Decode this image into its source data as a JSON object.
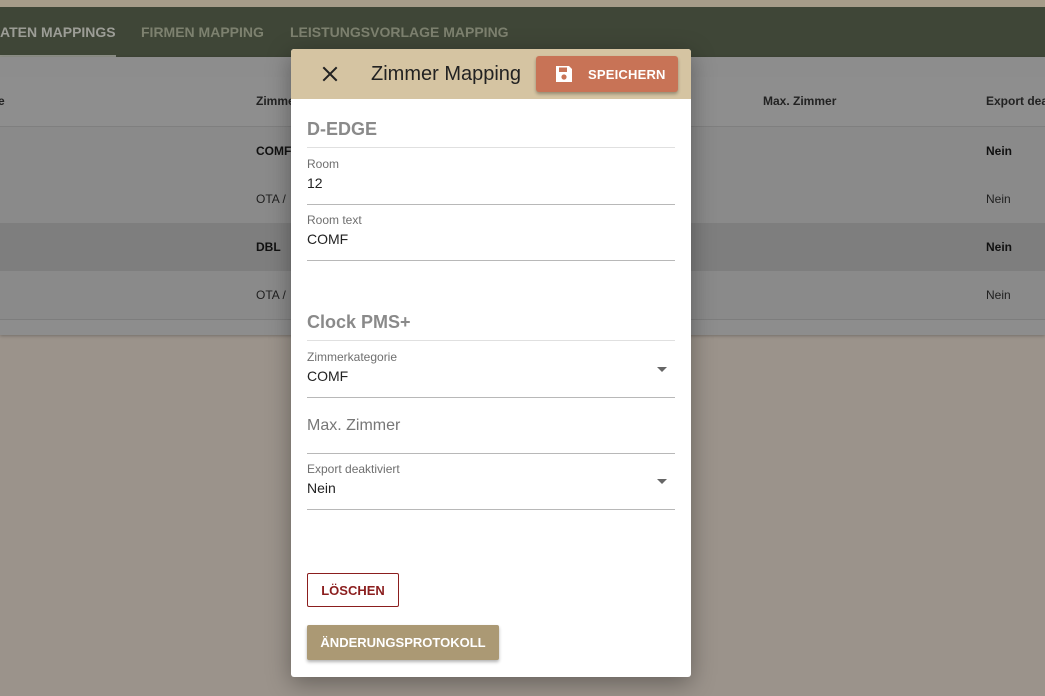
{
  "tabs": [
    {
      "label": "ATEN MAPPINGS",
      "active": true
    },
    {
      "label": "FIRMEN MAPPING",
      "active": false
    },
    {
      "label": "LEISTUNGSVORLAGE MAPPING",
      "active": false
    }
  ],
  "table": {
    "headers": [
      "e",
      "Zimme",
      "Max. Zimmer",
      "Export deak"
    ],
    "rows": [
      {
        "zimmer": "COMF",
        "export": "Nein"
      },
      {
        "zimmer": "OTA /",
        "export": "Nein"
      },
      {
        "zimmer": "DBL",
        "export": "Nein"
      },
      {
        "zimmer": "OTA /",
        "export": "Nein"
      }
    ]
  },
  "dialog": {
    "title": "Zimmer Mapping",
    "close_icon": "close-icon",
    "save_label": "SPEICHERN",
    "save_icon": "save-icon",
    "section_source": "D-EDGE",
    "room": {
      "label": "Room",
      "value": "12"
    },
    "room_text": {
      "label": "Room text",
      "value": "COMF"
    },
    "section_target": "Clock PMS+",
    "zimmerkategorie": {
      "label": "Zimmerkategorie",
      "value": "COMF"
    },
    "max_zimmer": {
      "placeholder": "Max. Zimmer"
    },
    "export_deaktiviert": {
      "label": "Export deaktiviert",
      "value": "Nein"
    },
    "delete_label": "LÖSCHEN",
    "history_label": "ÄNDERUNGSPROTOKOLL"
  },
  "colors": {
    "header": "#d5c4a2",
    "save_button": "#c87356",
    "delete_accent": "#8b1e1e",
    "history_button": "#ab9974",
    "tabbar": "#3f4637"
  }
}
